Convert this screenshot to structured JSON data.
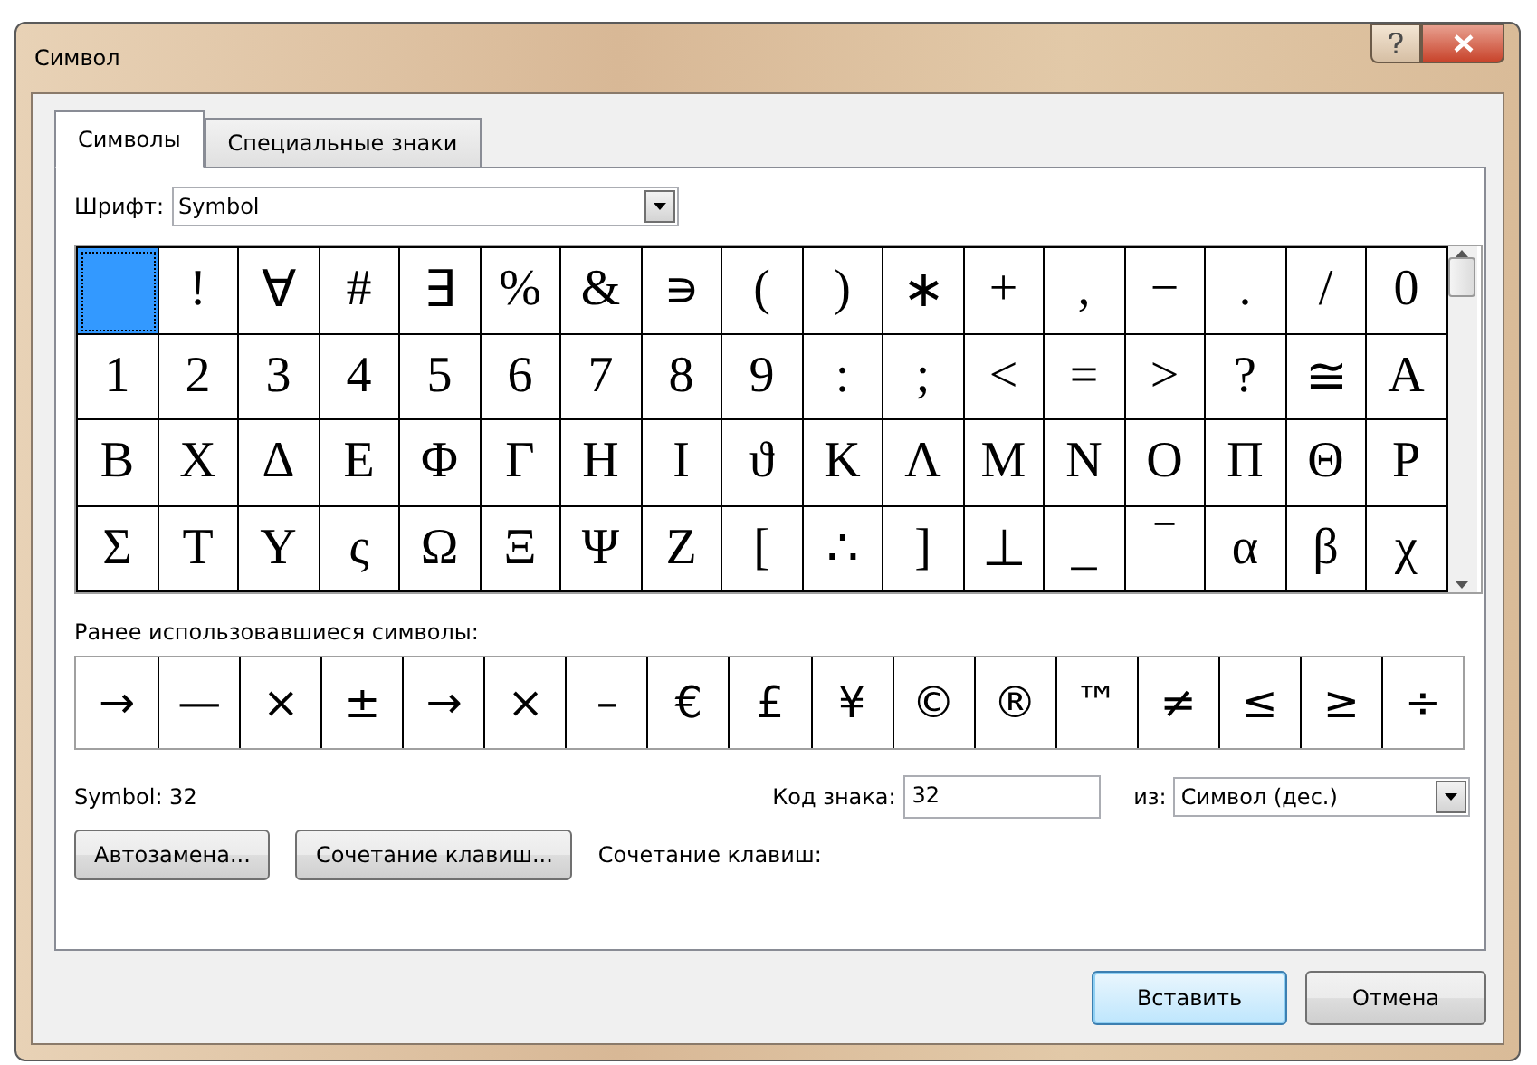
{
  "window": {
    "title": "Символ"
  },
  "tabs": [
    {
      "label": "Символы",
      "selected": true
    },
    {
      "label": "Специальные знаки",
      "selected": false
    }
  ],
  "font": {
    "label": "Шрифт:",
    "value": "Symbol"
  },
  "symbols": [
    {
      "selected": true
    },
    {
      "char": "!",
      "selected": false
    },
    {
      "char": "∀",
      "selected": false
    },
    {
      "char": "#",
      "selected": false
    },
    {
      "char": "∃",
      "selected": false
    },
    {
      "char": "%",
      "selected": false
    },
    {
      "char": "&",
      "selected": false
    },
    {
      "char": "∍",
      "selected": false
    },
    {
      "char": "(",
      "selected": false
    },
    {
      "char": ")",
      "selected": false
    },
    {
      "char": "∗",
      "selected": false
    },
    {
      "char": "+",
      "selected": false
    },
    {
      "char": ",",
      "selected": false
    },
    {
      "char": "−",
      "selected": false
    },
    {
      "char": ".",
      "selected": false
    },
    {
      "char": "/",
      "selected": false
    },
    {
      "char": "0",
      "selected": false
    },
    {
      "char": "1",
      "selected": false
    },
    {
      "char": "2",
      "selected": false
    },
    {
      "char": "3",
      "selected": false
    },
    {
      "char": "4",
      "selected": false
    },
    {
      "char": "5",
      "selected": false
    },
    {
      "char": "6",
      "selected": false
    },
    {
      "char": "7",
      "selected": false
    },
    {
      "char": "8",
      "selected": false
    },
    {
      "char": "9",
      "selected": false
    },
    {
      "char": ":",
      "selected": false
    },
    {
      "char": ";",
      "selected": false
    },
    {
      "char": "<",
      "selected": false
    },
    {
      "char": "=",
      "selected": false
    },
    {
      "char": ">",
      "selected": false
    },
    {
      "char": "?",
      "selected": false
    },
    {
      "char": "≅",
      "selected": false
    },
    {
      "char": "Α",
      "selected": false
    },
    {
      "char": "Β",
      "selected": false
    },
    {
      "char": "Χ",
      "selected": false
    },
    {
      "char": "Δ",
      "selected": false
    },
    {
      "char": "Ε",
      "selected": false
    },
    {
      "char": "Φ",
      "selected": false
    },
    {
      "char": "Γ",
      "selected": false
    },
    {
      "char": "Η",
      "selected": false
    },
    {
      "char": "Ι",
      "selected": false
    },
    {
      "char": "ϑ",
      "selected": false
    },
    {
      "char": "Κ",
      "selected": false
    },
    {
      "char": "Λ",
      "selected": false
    },
    {
      "char": "Μ",
      "selected": false
    },
    {
      "char": "Ν",
      "selected": false
    },
    {
      "char": "Ο",
      "selected": false
    },
    {
      "char": "Π",
      "selected": false
    },
    {
      "char": "Θ",
      "selected": false
    },
    {
      "char": "Ρ",
      "selected": false
    },
    {
      "char": "Σ",
      "selected": false
    },
    {
      "char": "Τ",
      "selected": false
    },
    {
      "char": "Υ",
      "selected": false
    },
    {
      "char": "ς",
      "selected": false
    },
    {
      "char": "Ω",
      "selected": false
    },
    {
      "char": "Ξ",
      "selected": false
    },
    {
      "char": "Ψ",
      "selected": false
    },
    {
      "char": "Ζ",
      "selected": false
    },
    {
      "char": "[",
      "selected": false
    },
    {
      "char": "∴",
      "selected": false
    },
    {
      "char": "]",
      "selected": false
    },
    {
      "char": "⊥",
      "selected": false
    },
    {
      "char": "_",
      "selected": false
    },
    {
      "char": "‾",
      "selected": false
    },
    {
      "char": "α",
      "selected": false
    },
    {
      "char": "β",
      "selected": false
    },
    {
      "char": "χ",
      "selected": false
    }
  ],
  "recent": {
    "label": "Ранее использовавшиеся символы:",
    "symbols": [
      "→",
      "—",
      "×",
      "±",
      "→",
      "×",
      "–",
      "€",
      "£",
      "¥",
      "©",
      "®",
      "™",
      "≠",
      "≤",
      "≥",
      "÷"
    ]
  },
  "symbol_name": "Symbol: 32",
  "char_code": {
    "label": "Код знака:",
    "value": "32"
  },
  "from": {
    "label": "из:",
    "value": "Символ (дес.)"
  },
  "autocorrect_button": "Автозамена...",
  "shortcut_button": "Сочетание клавиш...",
  "shortcut_label": "Сочетание клавиш:",
  "buttons": [
    {
      "label": "Вставить",
      "default": true
    },
    {
      "label": "Отмена",
      "default": false
    }
  ]
}
